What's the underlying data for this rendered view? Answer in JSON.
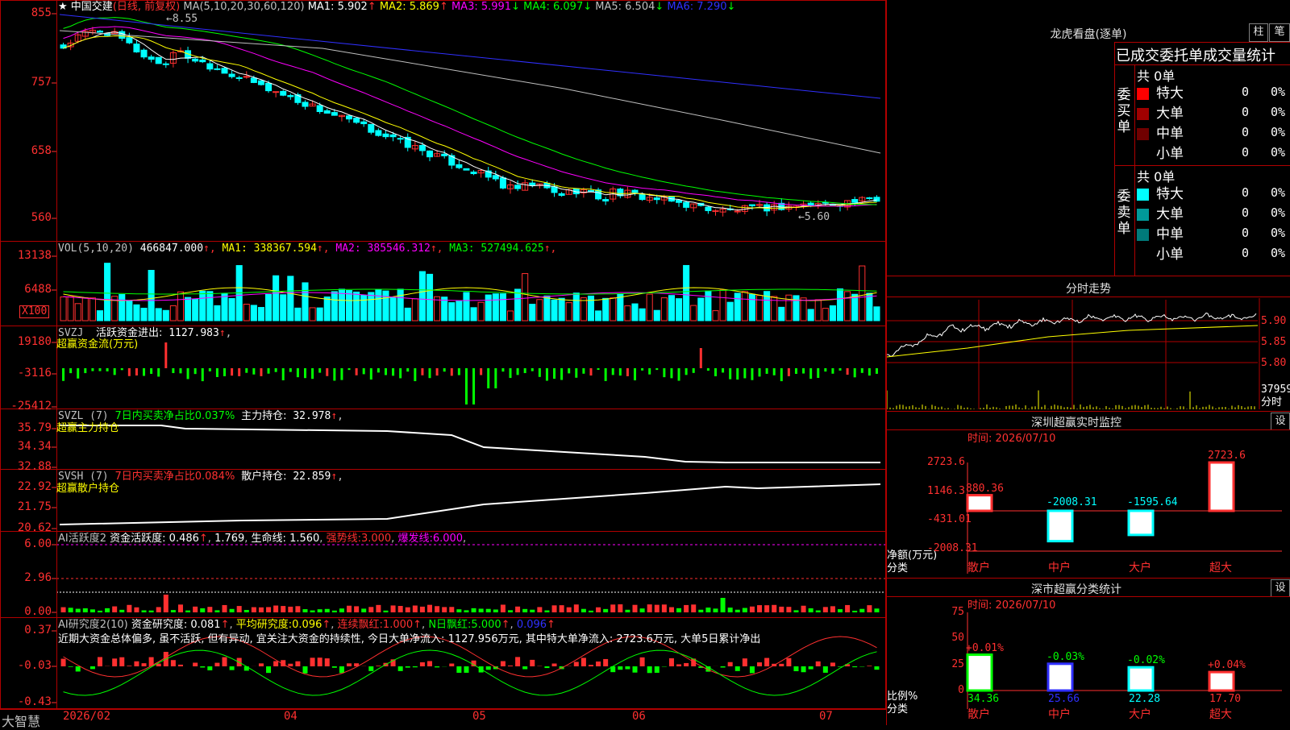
{
  "app": {
    "brand": "大智慧"
  },
  "main": {
    "stock_name": "中国交建",
    "period": "(日线, 前复权)",
    "ma_header": "MA(5,10,20,30,60,120)",
    "ma": [
      {
        "label": "MA1:",
        "value": "5.902",
        "arrow": "↑",
        "color": "#ffffff"
      },
      {
        "label": "MA2:",
        "value": "5.869",
        "arrow": "↑",
        "color": "#ffff00"
      },
      {
        "label": "MA3:",
        "value": "5.991",
        "arrow": "↓",
        "color": "#ff00ff"
      },
      {
        "label": "MA4:",
        "value": "6.097",
        "arrow": "↓",
        "color": "#00ff00"
      },
      {
        "label": "MA5:",
        "value": "6.504",
        "arrow": "↓",
        "color": "#c0c0c0"
      },
      {
        "label": "MA6:",
        "value": "7.290",
        "arrow": "↓",
        "color": "#3030ff"
      }
    ],
    "y_ticks": [
      "855",
      "757",
      "658",
      "560"
    ],
    "high_label": "←8.55",
    "low_label": "←5.60"
  },
  "vol": {
    "header": "VOL(5,10,20)",
    "value": "466847.000",
    "ma": [
      {
        "label": "MA1:",
        "value": "338367.594",
        "color": "#ffff00"
      },
      {
        "label": "MA2:",
        "value": "385546.312",
        "color": "#ff00ff"
      },
      {
        "label": "MA3:",
        "value": "527494.625",
        "color": "#00ff00"
      }
    ],
    "y_ticks": [
      "13138",
      "6488"
    ],
    "unit": "X100"
  },
  "svzj": {
    "header": "SVZJ",
    "label": "活跃资金进出:",
    "value": "1127.983",
    "sub": "超赢资金流(万元)",
    "y_ticks": [
      "19180",
      "-3116",
      "-25412"
    ]
  },
  "svzl": {
    "header": "SVZL (7)",
    "ratio_label": "7日内买卖净占比0.037%",
    "hold_label": "主力持仓:",
    "hold_value": "32.978",
    "sub": "超赢主力持仓",
    "y_ticks": [
      "35.79",
      "34.34",
      "32.88"
    ]
  },
  "svsh": {
    "header": "SVSH (7)",
    "ratio_label": "7日内买卖净占比0.084%",
    "hold_label": "散户持仓:",
    "hold_value": "22.859",
    "sub": "超赢散户持仓",
    "y_ticks": [
      "22.92",
      "21.75",
      "20.62"
    ]
  },
  "ai_active": {
    "header": "AI活跃度2",
    "label": "资金活跃度:",
    "v1": "0.486",
    "v2": "1.769",
    "life_label": "生命线:",
    "life_value": "1.560",
    "strong_label": "强势线:",
    "strong_value": "3.000",
    "burst_label": "爆发线:",
    "burst_value": "6.000",
    "y_ticks": [
      "6.00",
      "2.96",
      "0.00"
    ]
  },
  "ai_research": {
    "header": "AI研究度2(10)",
    "label": "资金研究度:",
    "value": "0.081",
    "avg_label": "平均研究度:",
    "avg_value": "0.096",
    "red_label": "连续飘红:",
    "red_value": "1.000",
    "nred_label": "N日飘红:",
    "nred_value": "5.000",
    "extra_value": "0.096",
    "comment": "近期大资金总体偏多, 虽不活跃, 但有异动, 宜关注大资金的持续性, 今日大单净流入: 1127.956万元, 其中特大单净流入: 2723.6万元, 大单5日累计净出",
    "y_ticks": [
      "0.37",
      "-0.03",
      "-0.43"
    ]
  },
  "x_axis": [
    "2026/02",
    "04",
    "05",
    "06",
    "07"
  ],
  "dragon": {
    "title": "龙虎看盘(逐单)",
    "btn1": "柱",
    "btn2": "笔",
    "subtitle": "已成交委托单成交量统计",
    "buy_side": "委买单",
    "sell_side": "委卖单",
    "buy_total": "共 0单",
    "sell_total": "共 0单",
    "buy_rows": [
      {
        "name": "特大",
        "count": "0",
        "pct": "0%",
        "color": "#ff0000"
      },
      {
        "name": "大单",
        "count": "0",
        "pct": "0%",
        "color": "#a00000"
      },
      {
        "name": "中单",
        "count": "0",
        "pct": "0%",
        "color": "#700000"
      },
      {
        "name": "小单",
        "count": "0",
        "pct": "0%",
        "color": ""
      }
    ],
    "sell_rows": [
      {
        "name": "特大",
        "count": "0",
        "pct": "0%",
        "color": "#00ffff"
      },
      {
        "name": "大单",
        "count": "0",
        "pct": "0%",
        "color": "#009a9a"
      },
      {
        "name": "中单",
        "count": "0",
        "pct": "0%",
        "color": "#007a7a"
      },
      {
        "name": "小单",
        "count": "0",
        "pct": "0%",
        "color": ""
      }
    ]
  },
  "intraday": {
    "title": "分时走势",
    "y_ticks": [
      "5.90",
      "5.85",
      "5.80"
    ],
    "vol_value": "37959",
    "vol_label": "分时"
  },
  "monitor": {
    "title": "深圳超赢实时监控",
    "btn": "设",
    "time": "时间: 2026/07/10",
    "y_ticks": [
      "2723.6",
      "1146.3",
      "-431.01",
      "-2008.31"
    ],
    "y_unit": "净额(万元)",
    "x_unit": "分类",
    "bars": [
      {
        "name": "散户",
        "value": "880.36"
      },
      {
        "name": "中户",
        "value": "-2008.31"
      },
      {
        "name": "大户",
        "value": "-1595.64"
      },
      {
        "name": "超大",
        "value": "2723.6"
      }
    ]
  },
  "stats": {
    "title": "深市超赢分类统计",
    "btn": "设",
    "time": "时间: 2026/07/10",
    "y_ticks": [
      "75",
      "50",
      "25",
      "0"
    ],
    "y_unit": "比例%",
    "x_unit": "分类",
    "bars": [
      {
        "name": "散户",
        "value": "34.36",
        "change": "+0.01%"
      },
      {
        "name": "中户",
        "value": "25.66",
        "change": "-0.03%"
      },
      {
        "name": "大户",
        "value": "22.28",
        "change": "-0.02%"
      },
      {
        "name": "超大",
        "value": "17.70",
        "change": "+0.04%"
      }
    ]
  }
}
